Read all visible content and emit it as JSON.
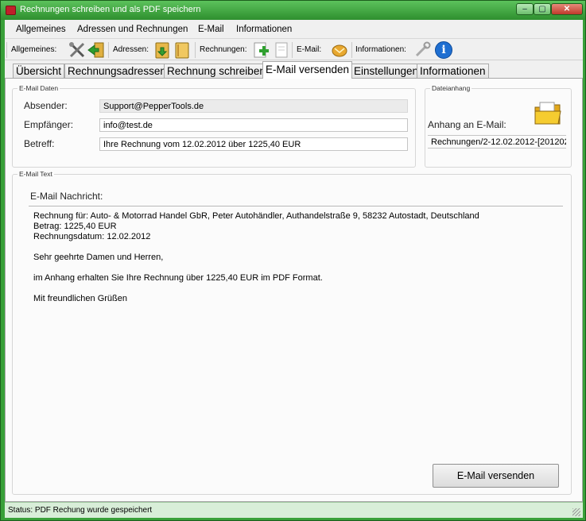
{
  "window": {
    "title": "Rechnungen schreiben und als PDF speichern",
    "min": "–",
    "max": "▢",
    "close": "✕"
  },
  "menu": [
    "Allgemeines",
    "Adressen und Rechnungen",
    "E-Mail",
    "Informationen"
  ],
  "toolbar": {
    "general_label": "Allgemeines:",
    "addresses_label": "Adressen:",
    "invoices_label": "Rechnungen:",
    "email_label": "E-Mail:",
    "info_label": "Informationen:",
    "info_glyph": "i"
  },
  "tabs": [
    "Übersicht",
    "Rechnungsadressen",
    "Rechnung schreiben",
    "E-Mail versenden",
    "Einstellungen",
    "Informationen"
  ],
  "active_tab": "E-Mail versenden",
  "email_data": {
    "group_title": "E-Mail Daten",
    "sender_label": "Absender:",
    "sender_value": "Support@PepperTools.de",
    "recipient_label": "Empfänger:",
    "recipient_value": "info@test.de",
    "subject_label": "Betreff:",
    "subject_value": "Ihre Rechnung vom 12.02.2012 über 1225,40 EUR"
  },
  "attachment": {
    "group_title": "Dateianhang",
    "label": "Anhang an E-Mail:",
    "value": "Rechnungen/2-12.02.2012-[201202"
  },
  "email_text": {
    "group_title": "E-Mail Text",
    "heading": "E-Mail Nachricht:",
    "lines": [
      "Rechnung für: Auto- & Motorrad Handel GbR, Peter Autohändler, Authandelstraße 9, 58232 Autostadt, Deutschland",
      "Betrag: 1225,40 EUR",
      "Rechnungsdatum: 12.02.2012",
      "",
      "Sehr geehrte Damen und Herren,",
      "",
      "im Anhang erhalten Sie Ihre Rechnung über 1225,40 EUR im PDF Format.",
      "",
      "Mit freundlichen Grüßen"
    ]
  },
  "send_button": "E-Mail versenden",
  "status": "Status:  PDF Rechung wurde gespeichert",
  "colors": {
    "frame": "#39a039",
    "info_icon": "#1f6fd1",
    "folder": "#f0c020"
  }
}
